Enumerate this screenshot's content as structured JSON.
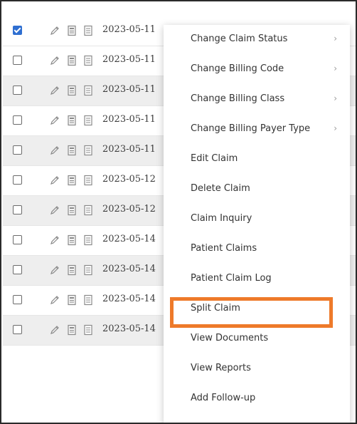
{
  "table": {
    "rows": [
      {
        "date": "2023-05-11",
        "checked": true
      },
      {
        "date": "2023-05-11",
        "checked": false
      },
      {
        "date": "2023-05-11",
        "checked": false
      },
      {
        "date": "2023-05-11",
        "checked": false
      },
      {
        "date": "2023-05-11",
        "checked": false
      },
      {
        "date": "2023-05-12",
        "checked": false
      },
      {
        "date": "2023-05-12",
        "checked": false
      },
      {
        "date": "2023-05-14",
        "checked": false
      },
      {
        "date": "2023-05-14",
        "checked": false
      },
      {
        "date": "2023-05-14",
        "checked": false
      },
      {
        "date": "2023-05-14",
        "checked": false
      }
    ]
  },
  "context_menu": {
    "items": [
      {
        "label": "Change Claim Status",
        "submenu": true
      },
      {
        "label": "Change Billing Code",
        "submenu": true
      },
      {
        "label": "Change Billing Class",
        "submenu": true
      },
      {
        "label": "Change Billing Payer Type",
        "submenu": true
      },
      {
        "label": "Edit Claim",
        "submenu": false
      },
      {
        "label": "Delete Claim",
        "submenu": false
      },
      {
        "label": "Claim Inquiry",
        "submenu": false
      },
      {
        "label": "Patient Claims",
        "submenu": false
      },
      {
        "label": "Patient Claim Log",
        "submenu": false
      },
      {
        "label": "Split Claim",
        "submenu": false
      },
      {
        "label": "View Documents",
        "submenu": false
      },
      {
        "label": "View Reports",
        "submenu": false
      },
      {
        "label": "Add Follow-up",
        "submenu": false
      }
    ],
    "highlighted_item": "Split Claim",
    "chevron_glyph": "›"
  },
  "colors": {
    "highlight_border": "#ee7a2a",
    "checkbox_checked": "#2f6fd1",
    "row_alt_bg": "#eeeeee"
  },
  "icons": {
    "row_icons": [
      "pencil-icon",
      "document-icon",
      "document-lines-icon"
    ]
  }
}
